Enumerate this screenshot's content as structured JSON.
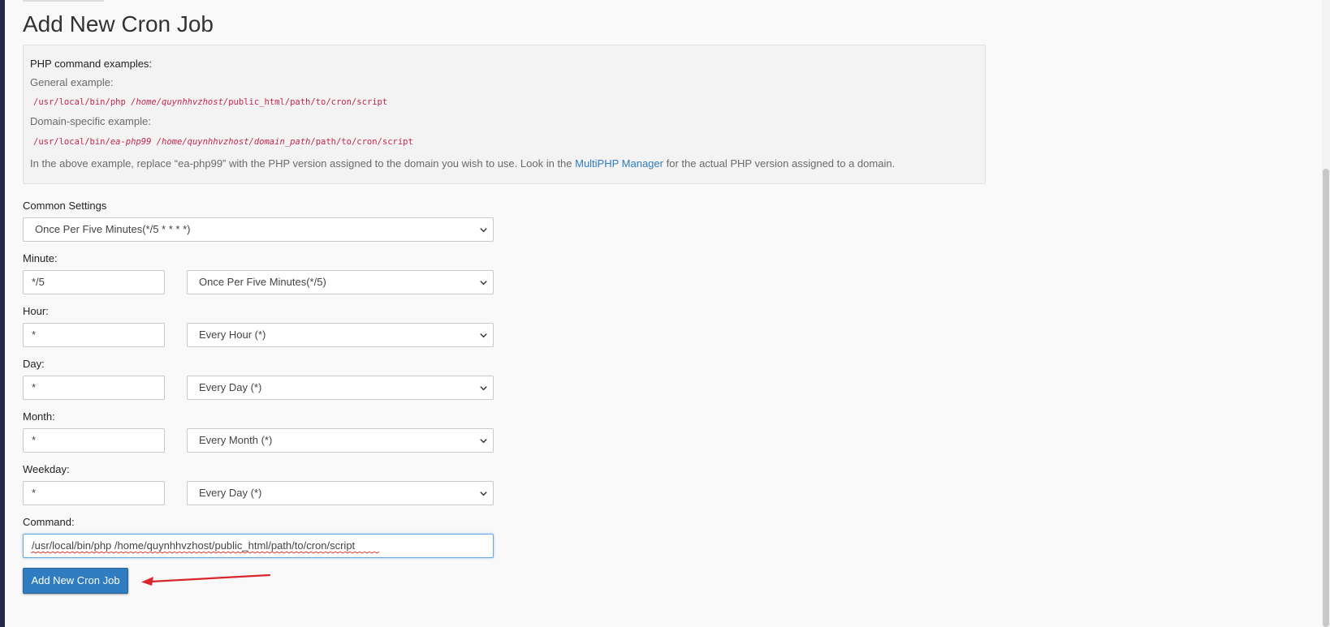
{
  "page": {
    "title": "Add New Cron Job"
  },
  "examples": {
    "heading": "PHP command examples:",
    "general_label": "General example:",
    "general_code_plain": "/usr/local/bin/php ",
    "general_code_italic": "/home/quynhhvzhost/",
    "general_code_rest": "public_html/path/to/cron/script",
    "domain_label": "Domain-specific example:",
    "domain_code_plain": "/usr/local/bin/",
    "domain_code_italic": "ea-php99 /home/quynhhvzhost/domain_path",
    "domain_code_rest": "/path/to/cron/script",
    "note_before": "In the above example, replace “ea-php99” with the PHP version assigned to the domain you wish to use. Look in the ",
    "note_link": "MultiPHP Manager",
    "note_after": " for the actual PHP version assigned to a domain."
  },
  "form": {
    "common_settings_label": "Common Settings",
    "common_settings_value": "Once Per Five Minutes(*/5 * * * *)",
    "minute_label": "Minute:",
    "minute_value": "*/5",
    "minute_select": "Once Per Five Minutes(*/5)",
    "hour_label": "Hour:",
    "hour_value": "*",
    "hour_select": "Every Hour (*)",
    "day_label": "Day:",
    "day_value": "*",
    "day_select": "Every Day (*)",
    "month_label": "Month:",
    "month_value": "*",
    "month_select": "Every Month (*)",
    "weekday_label": "Weekday:",
    "weekday_value": "*",
    "weekday_select": "Every Day (*)",
    "command_label": "Command:",
    "command_value": "/usr/local/bin/php /home/quynhhvzhost/public_html/path/to/cron/script",
    "submit_label": "Add New Cron Job"
  },
  "colors": {
    "accent": "#2f7cc0",
    "code": "#c7254e",
    "annotation_arrow": "#d9262c",
    "sidebar": "#22294a"
  }
}
